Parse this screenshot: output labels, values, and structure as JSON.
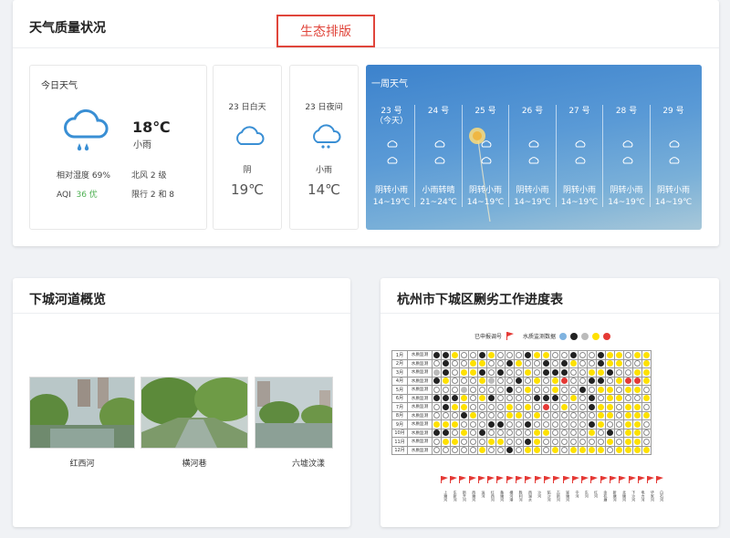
{
  "weather": {
    "title": "天气质量状况",
    "eco_button": "生态排版",
    "today": {
      "label": "今日天气",
      "temp": "18℃",
      "condition": "小雨",
      "humidity": "相对湿度 69%",
      "wind": "北风 2 级",
      "aqi_label": "AQI",
      "aqi_value": "36 优",
      "restriction": "限行 2 和 8"
    },
    "day": {
      "date": "23 日白天",
      "condition": "阴",
      "temp": "19℃"
    },
    "night": {
      "date": "23 日夜间",
      "condition": "小雨",
      "temp": "14℃"
    },
    "week": {
      "title": "一周天气",
      "days": [
        {
          "date": "23 号\n（今天）",
          "condition": "阴转小雨",
          "temp": "14~19℃"
        },
        {
          "date": "24 号",
          "condition": "小雨转晴",
          "temp": "21~24℃"
        },
        {
          "date": "25 号",
          "condition": "阴转小雨",
          "temp": "14~19℃"
        },
        {
          "date": "26 号",
          "condition": "阴转小雨",
          "temp": "14~19℃"
        },
        {
          "date": "27 号",
          "condition": "阴转小雨",
          "temp": "14~19℃"
        },
        {
          "date": "28 号",
          "condition": "阴转小雨",
          "temp": "14~19℃"
        },
        {
          "date": "29 号",
          "condition": "阴转小雨",
          "temp": "14~19℃"
        }
      ]
    }
  },
  "river": {
    "title": "下城河道概览",
    "photos": [
      {
        "caption": "红西河"
      },
      {
        "caption": "横河巷"
      },
      {
        "caption": "六墟汶漾"
      }
    ]
  },
  "progress": {
    "title": "杭州市下城区劂劣工作进度表",
    "legend_reported": "已申报调号",
    "legend_monitor": "水质监测数据",
    "months": [
      "1月",
      "2月",
      "3月",
      "4月",
      "5月",
      "6月",
      "7月",
      "8月",
      "9月",
      "10月",
      "11月",
      "12月"
    ],
    "row_label": "水质监测",
    "rivers": [
      "上塘河",
      "东新河",
      "新开河",
      "西塘河",
      "运河",
      "红西河",
      "备塘河",
      "横河港",
      "胜利河",
      "西湖水",
      "沙河",
      "贴沙河",
      "古新河",
      "宦塘河",
      "中河",
      "东河",
      "红河",
      "余杭塘",
      "新塘河",
      "北塘河",
      "下沙河",
      "电力河",
      "华家河",
      "白石河"
    ],
    "grid": [
      "kkywwkywwwkyywwkwwkyywyy",
      "wkwwyywwkywwkwkywwkyywwy",
      "gkwyykwkwwywkkkwwyykwwyy",
      "kywwwygwwkwywyrwwkkwyrry",
      "wwwgwwwwkwywwywwkwyywyyw",
      "kkkywykwwwwkkkwywkwyywwy",
      "wkyywwwwywywrwywwkyywyyw",
      "wwwkywwwyywywwwwwwyywyyy",
      "yyywwwkkwwkwwwwwwkywwyyw",
      "kkwywkwwwwwyywwwwywkwyyw",
      "wyywwwyywwkywwwwwwwywyyw",
      "wwwwwywwkwyywywyyyywyyyy"
    ]
  }
}
